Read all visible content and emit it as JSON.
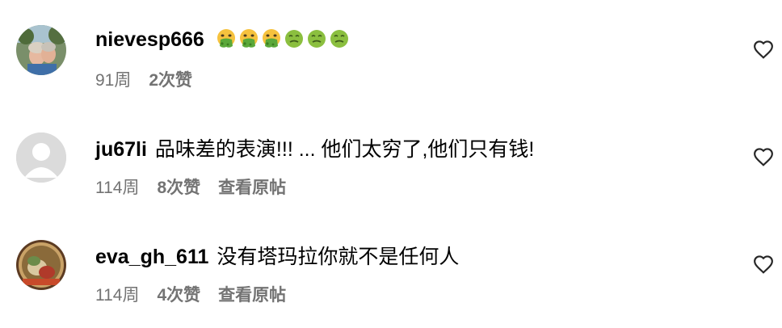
{
  "comments": [
    {
      "username": "nievesp666",
      "text": "",
      "emojis": [
        "nauseated-face-icon",
        "nauseated-face-icon",
        "nauseated-face-icon",
        "nauseated-green-face-icon",
        "nauseated-green-face-icon",
        "nauseated-green-face-icon"
      ],
      "time": "91周",
      "likes": "2次赞",
      "view_post": ""
    },
    {
      "username": "ju67li",
      "text": "品味差的表演!!! ... 他们太穷了,他们只有钱!",
      "emojis": [],
      "time": "114周",
      "likes": "8次赞",
      "view_post": "查看原帖"
    },
    {
      "username": "eva_gh_611",
      "text": "没有塔玛拉你就不是任何人",
      "emojis": [],
      "time": "114周",
      "likes": "4次赞",
      "view_post": "查看原帖"
    }
  ],
  "icons": {
    "like": "heart-outline-icon"
  },
  "colors": {
    "meta_text": "#737373",
    "text": "#000000",
    "background": "#ffffff"
  }
}
